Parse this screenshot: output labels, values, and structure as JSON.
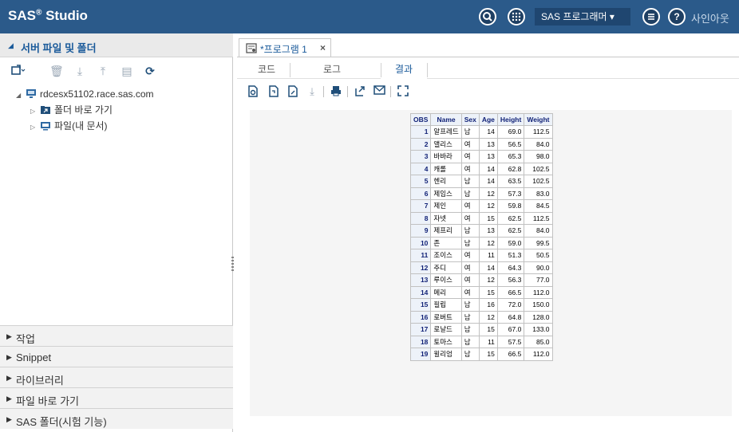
{
  "app": {
    "brand": "SAS",
    "brand_sup": "®",
    "brand_rest": " Studio",
    "mode_label": "SAS 프로그래머 ▾",
    "signout_label": "사인아웃"
  },
  "icons": {
    "search": "search-icon",
    "apps": "apps-icon",
    "menu": "menu-icon",
    "help": "help-icon"
  },
  "left_panel": {
    "title": "서버 파일 및 폴더",
    "tree": [
      {
        "label": "rdcesx51102.race.sas.com",
        "level": 0,
        "arrow": "◢"
      },
      {
        "label": "폴더 바로 가기",
        "level": 1,
        "arrow": "▷"
      },
      {
        "label": "파일(내 문서)",
        "level": 1,
        "arrow": "▷"
      }
    ],
    "sections": [
      {
        "label": "작업"
      },
      {
        "label": "Snippet"
      },
      {
        "label": "라이브러리"
      },
      {
        "label": "파일 바로 가기"
      },
      {
        "label": "SAS 폴더(시험 기능)"
      }
    ]
  },
  "editor": {
    "tab_label": "*프로그램 1",
    "tab_close": "×",
    "sub_tabs": [
      "코드",
      "로그",
      "결과"
    ],
    "active_sub_tab": "결과"
  },
  "output_table": {
    "headers": [
      "OBS",
      "Name",
      "Sex",
      "Age",
      "Height",
      "Weight"
    ],
    "rows": [
      [
        "1",
        "알프레드",
        "남",
        "14",
        "69.0",
        "112.5"
      ],
      [
        "2",
        "앨리스",
        "여",
        "13",
        "56.5",
        "84.0"
      ],
      [
        "3",
        "바바라",
        "여",
        "13",
        "65.3",
        "98.0"
      ],
      [
        "4",
        "캐롤",
        "여",
        "14",
        "62.8",
        "102.5"
      ],
      [
        "5",
        "헨리",
        "남",
        "14",
        "63.5",
        "102.5"
      ],
      [
        "6",
        "제임스",
        "남",
        "12",
        "57.3",
        "83.0"
      ],
      [
        "7",
        "제인",
        "여",
        "12",
        "59.8",
        "84.5"
      ],
      [
        "8",
        "자넷",
        "여",
        "15",
        "62.5",
        "112.5"
      ],
      [
        "9",
        "제프리",
        "남",
        "13",
        "62.5",
        "84.0"
      ],
      [
        "10",
        "존",
        "남",
        "12",
        "59.0",
        "99.5"
      ],
      [
        "11",
        "조이스",
        "여",
        "11",
        "51.3",
        "50.5"
      ],
      [
        "12",
        "주디",
        "여",
        "14",
        "64.3",
        "90.0"
      ],
      [
        "13",
        "루이스",
        "여",
        "12",
        "56.3",
        "77.0"
      ],
      [
        "14",
        "메리",
        "여",
        "15",
        "66.5",
        "112.0"
      ],
      [
        "15",
        "필립",
        "남",
        "16",
        "72.0",
        "150.0"
      ],
      [
        "16",
        "로버트",
        "남",
        "12",
        "64.8",
        "128.0"
      ],
      [
        "17",
        "로날드",
        "남",
        "15",
        "67.0",
        "133.0"
      ],
      [
        "18",
        "토마스",
        "남",
        "11",
        "57.5",
        "85.0"
      ],
      [
        "19",
        "윌리엄",
        "남",
        "15",
        "66.5",
        "112.0"
      ]
    ]
  },
  "colors": {
    "topbar": "#2b5a8a",
    "accent": "#1a5a9a",
    "table_header_bg": "#edf2f9"
  }
}
